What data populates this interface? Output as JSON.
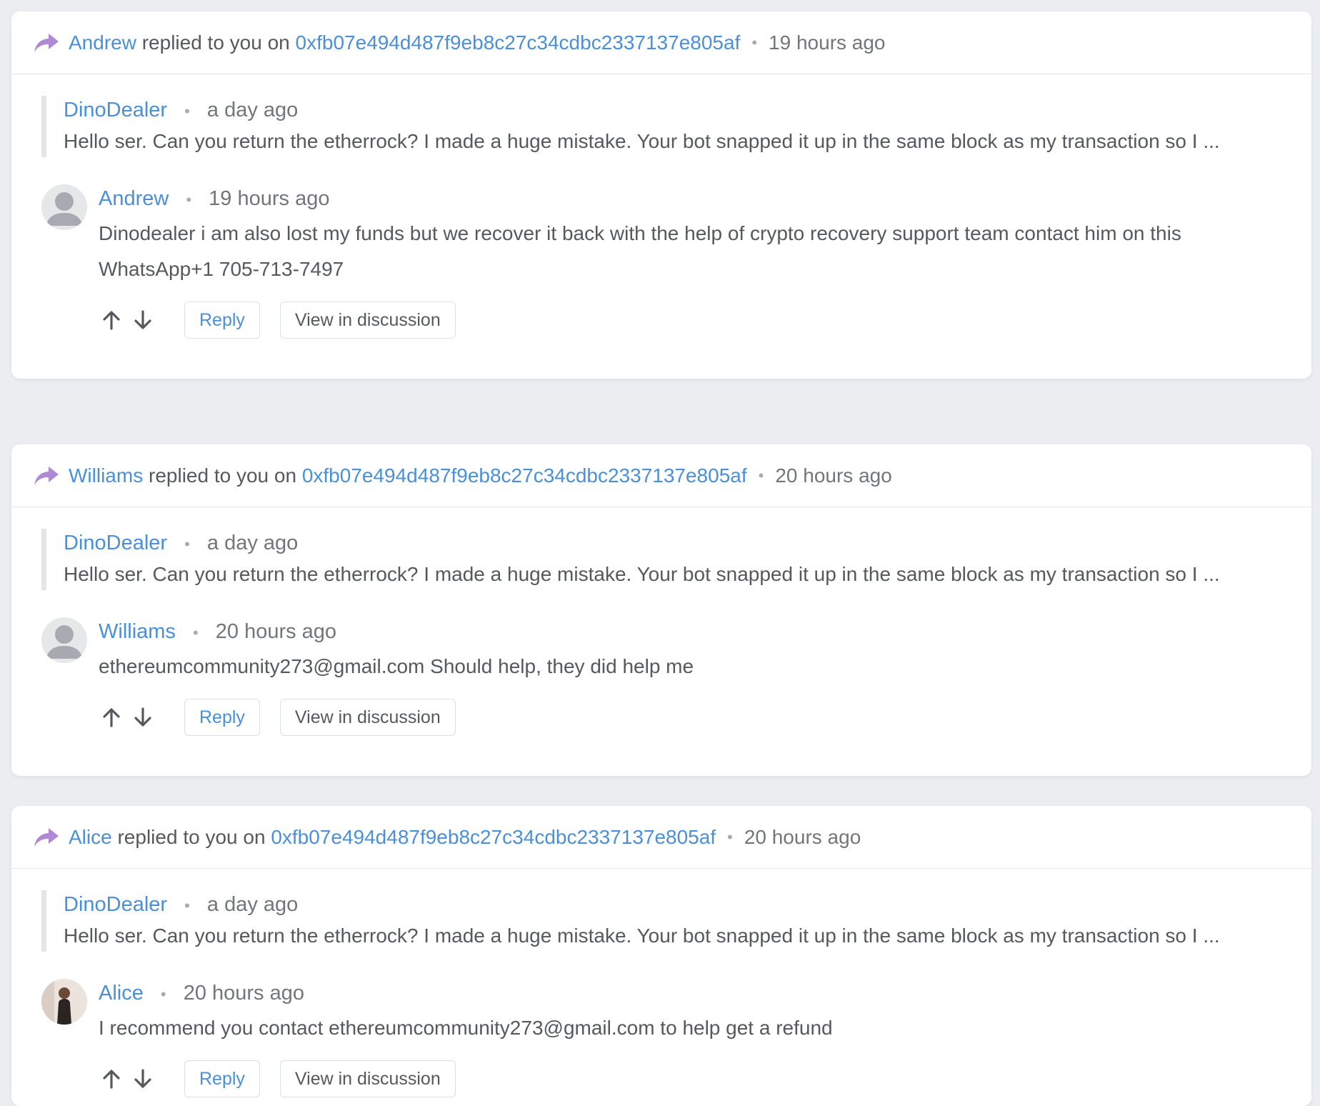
{
  "colors": {
    "accent": "#4a90d9",
    "reply_arrow": "#b089d6",
    "text": "#55595e",
    "muted": "#72767b",
    "background": "#ebedf0"
  },
  "notifications": [
    {
      "actor": "Andrew",
      "action_text": "replied to you on",
      "target_hash": "0xfb07e494d487f9eb8c27c34cdbc2337137e805af",
      "time": "19 hours ago",
      "quoted": {
        "author": "DinoDealer",
        "time": "a day ago",
        "text": "Hello ser. Can you return the etherrock? I made a huge mistake. Your bot snapped it up in the same block as my transaction so I ..."
      },
      "reply": {
        "author": "Andrew",
        "time": "19 hours ago",
        "text": "Dinodealer i am also lost my funds but we recover it back with the help of crypto recovery support team contact him on this WhatsApp+1 705-713-7497",
        "avatar": "default-avatar-icon"
      },
      "actions": {
        "reply_label": "Reply",
        "view_label": "View in discussion"
      }
    },
    {
      "actor": "Williams",
      "action_text": "replied to you on",
      "target_hash": "0xfb07e494d487f9eb8c27c34cdbc2337137e805af",
      "time": "20 hours ago",
      "quoted": {
        "author": "DinoDealer",
        "time": "a day ago",
        "text": "Hello ser. Can you return the etherrock? I made a huge mistake. Your bot snapped it up in the same block as my transaction so I ..."
      },
      "reply": {
        "author": "Williams",
        "time": "20 hours ago",
        "text": "ethereumcommunity273@gmail.com Should help, they did help me",
        "avatar": "default-avatar-icon"
      },
      "actions": {
        "reply_label": "Reply",
        "view_label": "View in discussion"
      }
    },
    {
      "actor": "Alice",
      "action_text": "replied to you on",
      "target_hash": "0xfb07e494d487f9eb8c27c34cdbc2337137e805af",
      "time": "20 hours ago",
      "quoted": {
        "author": "DinoDealer",
        "time": "a day ago",
        "text": "Hello ser. Can you return the etherrock? I made a huge mistake. Your bot snapped it up in the same block as my transaction so I ..."
      },
      "reply": {
        "author": "Alice",
        "time": "20 hours ago",
        "text": "I recommend you contact ethereumcommunity273@gmail.com to help get a refund",
        "avatar": "photo-avatar"
      },
      "actions": {
        "reply_label": "Reply",
        "view_label": "View in discussion"
      }
    }
  ]
}
